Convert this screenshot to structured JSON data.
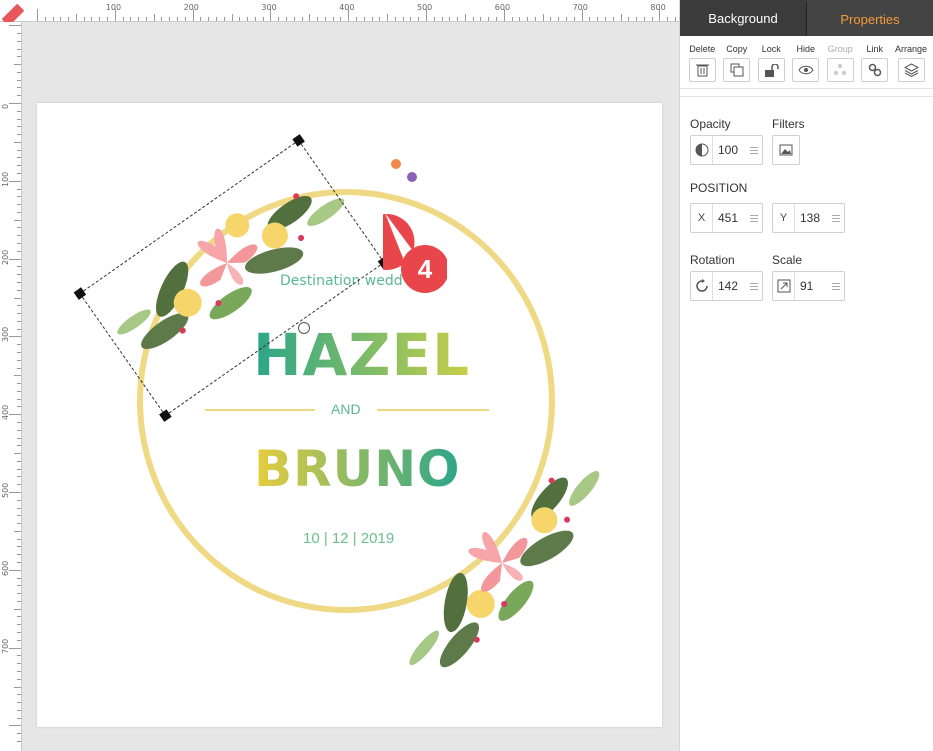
{
  "ruler": {
    "h_labels": [
      "100",
      "200",
      "300",
      "400",
      "500",
      "600",
      "700",
      "800"
    ],
    "v_labels": [
      "0",
      "100",
      "200",
      "300",
      "400",
      "500",
      "600",
      "700"
    ]
  },
  "canvas": {
    "subtitle": "Destination wedd",
    "name1": "HAZEL",
    "and": "AND",
    "name2": "BRUNO",
    "date": "10 | 12 | 2019",
    "step_badge": "4"
  },
  "panel": {
    "tabs": [
      {
        "label": "Background",
        "active": false
      },
      {
        "label": "Properties",
        "active": true
      }
    ],
    "toolbar": [
      {
        "label": "Delete",
        "icon": "trash-icon"
      },
      {
        "label": "Copy",
        "icon": "copy-icon"
      },
      {
        "label": "Lock",
        "icon": "unlock-icon"
      },
      {
        "label": "Hide",
        "icon": "eye-icon"
      },
      {
        "label": "Group",
        "icon": "group-icon",
        "disabled": true
      },
      {
        "label": "Link",
        "icon": "link-icon"
      },
      {
        "label": "Arrange",
        "icon": "layers-icon"
      }
    ],
    "opacity_label": "Opacity",
    "opacity_value": "100",
    "filters_label": "Filters",
    "position_label": "POSITION",
    "x_label": "X",
    "x_value": "451",
    "y_label": "Y",
    "y_value": "138",
    "rotation_label": "Rotation",
    "rotation_value": "142",
    "scale_label": "Scale",
    "scale_value": "91"
  },
  "colors": {
    "accent": "#f39b38",
    "tab_bg": "#3b3b3b",
    "badge": "#e8464b",
    "ring": "#efd985"
  }
}
